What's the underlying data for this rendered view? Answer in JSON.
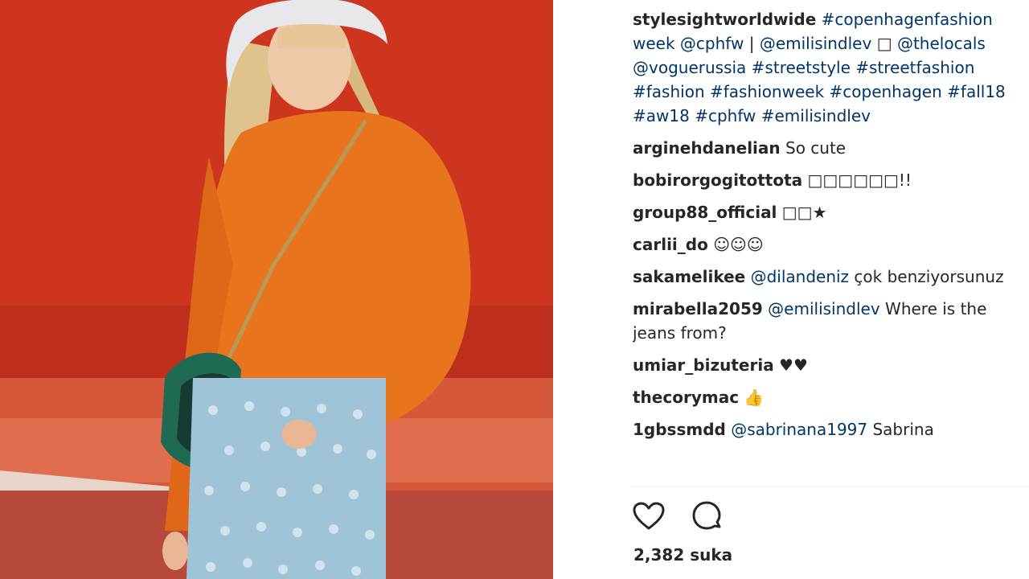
{
  "post": {
    "caption": {
      "username": "stylesightworldwide",
      "tokens": [
        "#copenhagenfashion",
        "week",
        "@cphfw",
        "|",
        "@emilisindlev",
        "□",
        "@thelocals",
        "@voguerussia",
        "#streetstyle",
        "#streetfashion",
        "#fashion",
        "#fashionweek",
        "#copenhagen",
        "#fall18",
        "#aw18",
        "#cphfw",
        "#emilisindlev"
      ]
    },
    "comments": [
      {
        "username": "arginehdanelian",
        "text": "So cute"
      },
      {
        "username": "bobirorgogitottota",
        "text": "□□□□□□!!"
      },
      {
        "username": "group88_official",
        "text": "□□★"
      },
      {
        "username": "carlii_do",
        "text": "☺☺☺"
      },
      {
        "username": "sakamelikee",
        "mention": "@dilandeniz",
        "text": "çok benziyorsunuz"
      },
      {
        "username": "mirabella2059",
        "mention": "@emilisindlev",
        "text": "Where is the jeans from?"
      },
      {
        "username": "umiar_bizuteria",
        "text": "♥♥"
      },
      {
        "username": "thecorymac",
        "text": "👍"
      },
      {
        "username": "1gbssmdd",
        "mention": "@sabrinana1997",
        "text": "Sabrina"
      }
    ],
    "likes_text": "2,382 suka"
  },
  "icons": [
    "heart-icon",
    "comment-icon"
  ],
  "colors": {
    "link": "#003569",
    "text": "#262626",
    "background": "#ffffff",
    "divider": "#efefef"
  }
}
